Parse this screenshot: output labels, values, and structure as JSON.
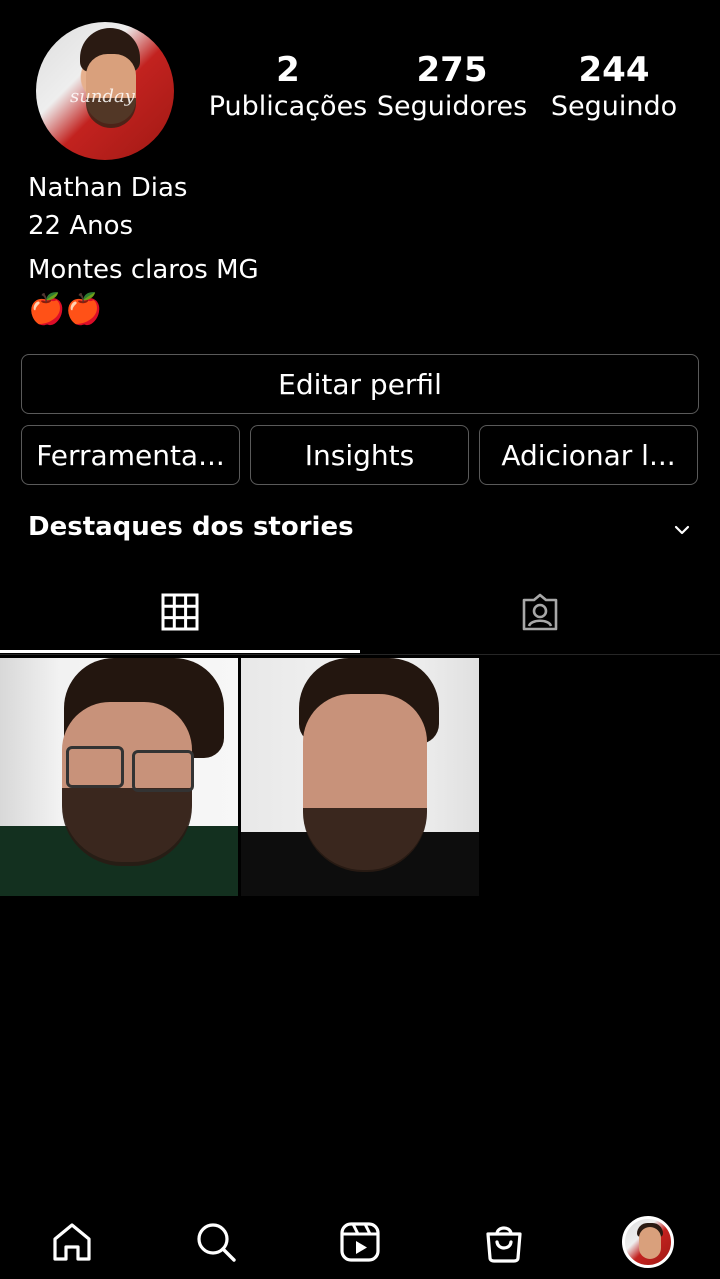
{
  "profile": {
    "stats": [
      {
        "value": "2",
        "label": "Publicações"
      },
      {
        "value": "275",
        "label": "Seguidores"
      },
      {
        "value": "244",
        "label": "Seguindo"
      }
    ],
    "avatar_script": "sunday",
    "name": "Nathan Dias",
    "bio_lines": [
      "22 Anos",
      "Montes claros MG"
    ],
    "emoji": "🍎🍎"
  },
  "buttons": {
    "edit_profile": "Editar perfil",
    "tools": "Ferramenta...",
    "insights": "Insights",
    "add": "Adicionar l..."
  },
  "highlights": {
    "title": "Destaques dos stories"
  },
  "tabs": [
    {
      "icon": "grid-icon",
      "active": true
    },
    {
      "icon": "tagged-icon",
      "active": false
    }
  ],
  "bottom_nav": [
    {
      "icon": "home-icon"
    },
    {
      "icon": "search-icon"
    },
    {
      "icon": "reels-icon"
    },
    {
      "icon": "shop-icon"
    },
    {
      "icon": "profile-avatar"
    }
  ]
}
